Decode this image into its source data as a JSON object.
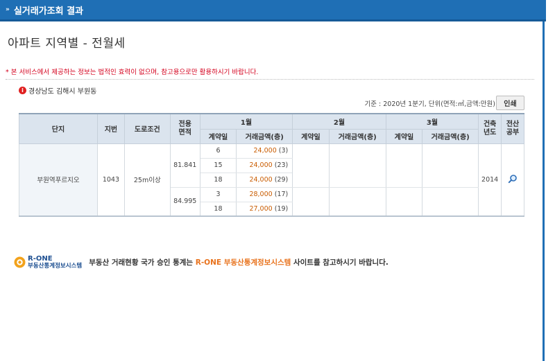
{
  "header": {
    "chevron": "»",
    "title": "실거래가조회 결과"
  },
  "page_title": "아파트 지역별 - 전월세",
  "notice": "* 본 서비스에서 제공하는 정보는 법적인 효력이 없으며, 참고용으로만 활용하시기 바랍니다.",
  "region": {
    "icon": "info-icon",
    "icon_glyph": "i",
    "text": "경상남도 김해시 부원동"
  },
  "criteria": "기준 : 2020년 1분기, 단위(면적:㎡,금액:만원)",
  "print_label": "인쇄",
  "table": {
    "headers": {
      "danji": "단지",
      "jibun": "지번",
      "road": "도로조건",
      "area": "전용\n면적",
      "month1": "1월",
      "month2": "2월",
      "month3": "3월",
      "built": "건축\n년도",
      "register": "전산\n공부",
      "contract_day": "계약일",
      "amount": "거래금액(층)"
    },
    "complex": {
      "name": "부원역푸르지오",
      "jibun": "1043",
      "road": "25m이상",
      "built": "2014",
      "register_icon": "magnifier-icon"
    },
    "groups": [
      {
        "area": "81.841",
        "rows": [
          {
            "day": "6",
            "amount": "24,000",
            "floor": "(3)"
          },
          {
            "day": "15",
            "amount": "24,000",
            "floor": "(23)"
          },
          {
            "day": "18",
            "amount": "24,000",
            "floor": "(29)"
          }
        ]
      },
      {
        "area": "84.995",
        "rows": [
          {
            "day": "3",
            "amount": "28,000",
            "floor": "(17)"
          },
          {
            "day": "18",
            "amount": "27,000",
            "floor": "(19)"
          }
        ]
      }
    ]
  },
  "footer": {
    "logo_name": "R-ONE",
    "logo_sub": "부동산통계정보시스템",
    "message_prefix": "부동산 거래현황 국가 승인 통계는 ",
    "message_highlight": "R-ONE 부동산통계정보시스템",
    "message_suffix": " 사이트를 참고하시기 바랍니다."
  },
  "colors": {
    "header_bg": "#1f6fb5",
    "notice_red": "#d4001d",
    "amount_orange": "#c95c00",
    "highlight_orange": "#e8721c"
  }
}
